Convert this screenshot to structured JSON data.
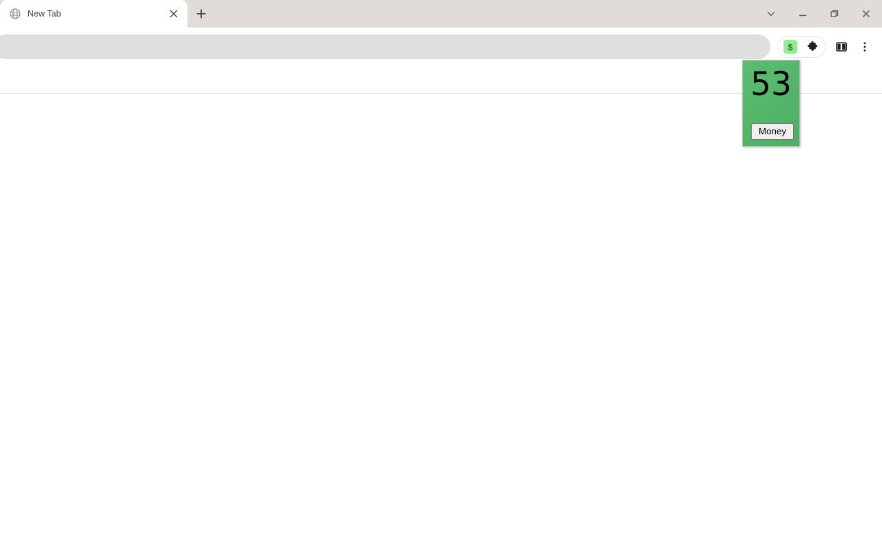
{
  "window": {
    "controls": [
      {
        "name": "tab-search-button",
        "icon": "chevron-down-icon",
        "label": "Search tabs"
      },
      {
        "name": "minimize-button",
        "icon": "minimize-icon",
        "label": "Minimize"
      },
      {
        "name": "maximize-button",
        "icon": "maximize-icon",
        "label": "Maximize"
      },
      {
        "name": "close-window-button",
        "icon": "close-icon",
        "label": "Close"
      }
    ]
  },
  "tabstrip": {
    "tabs": [
      {
        "title": "New Tab",
        "favicon": "globe-icon",
        "close_label": "Close tab",
        "active": true
      }
    ],
    "new_tab_label": "New tab"
  },
  "toolbar": {
    "omnibox": {
      "value": "",
      "placeholder": ""
    },
    "extension_action": {
      "name": "money-extension-action",
      "glyph": "$",
      "title": "Money",
      "badge_color": "#90ee90"
    },
    "extensions_button_label": "Extensions",
    "side_panel_button_label": "Side panel",
    "menu_button_label": "Customize and control Google Chrome"
  },
  "popup": {
    "count": "53",
    "button_label": "Money",
    "background_start": "#5cbd72",
    "background_end": "#4caf62"
  },
  "page": {
    "content": ""
  }
}
